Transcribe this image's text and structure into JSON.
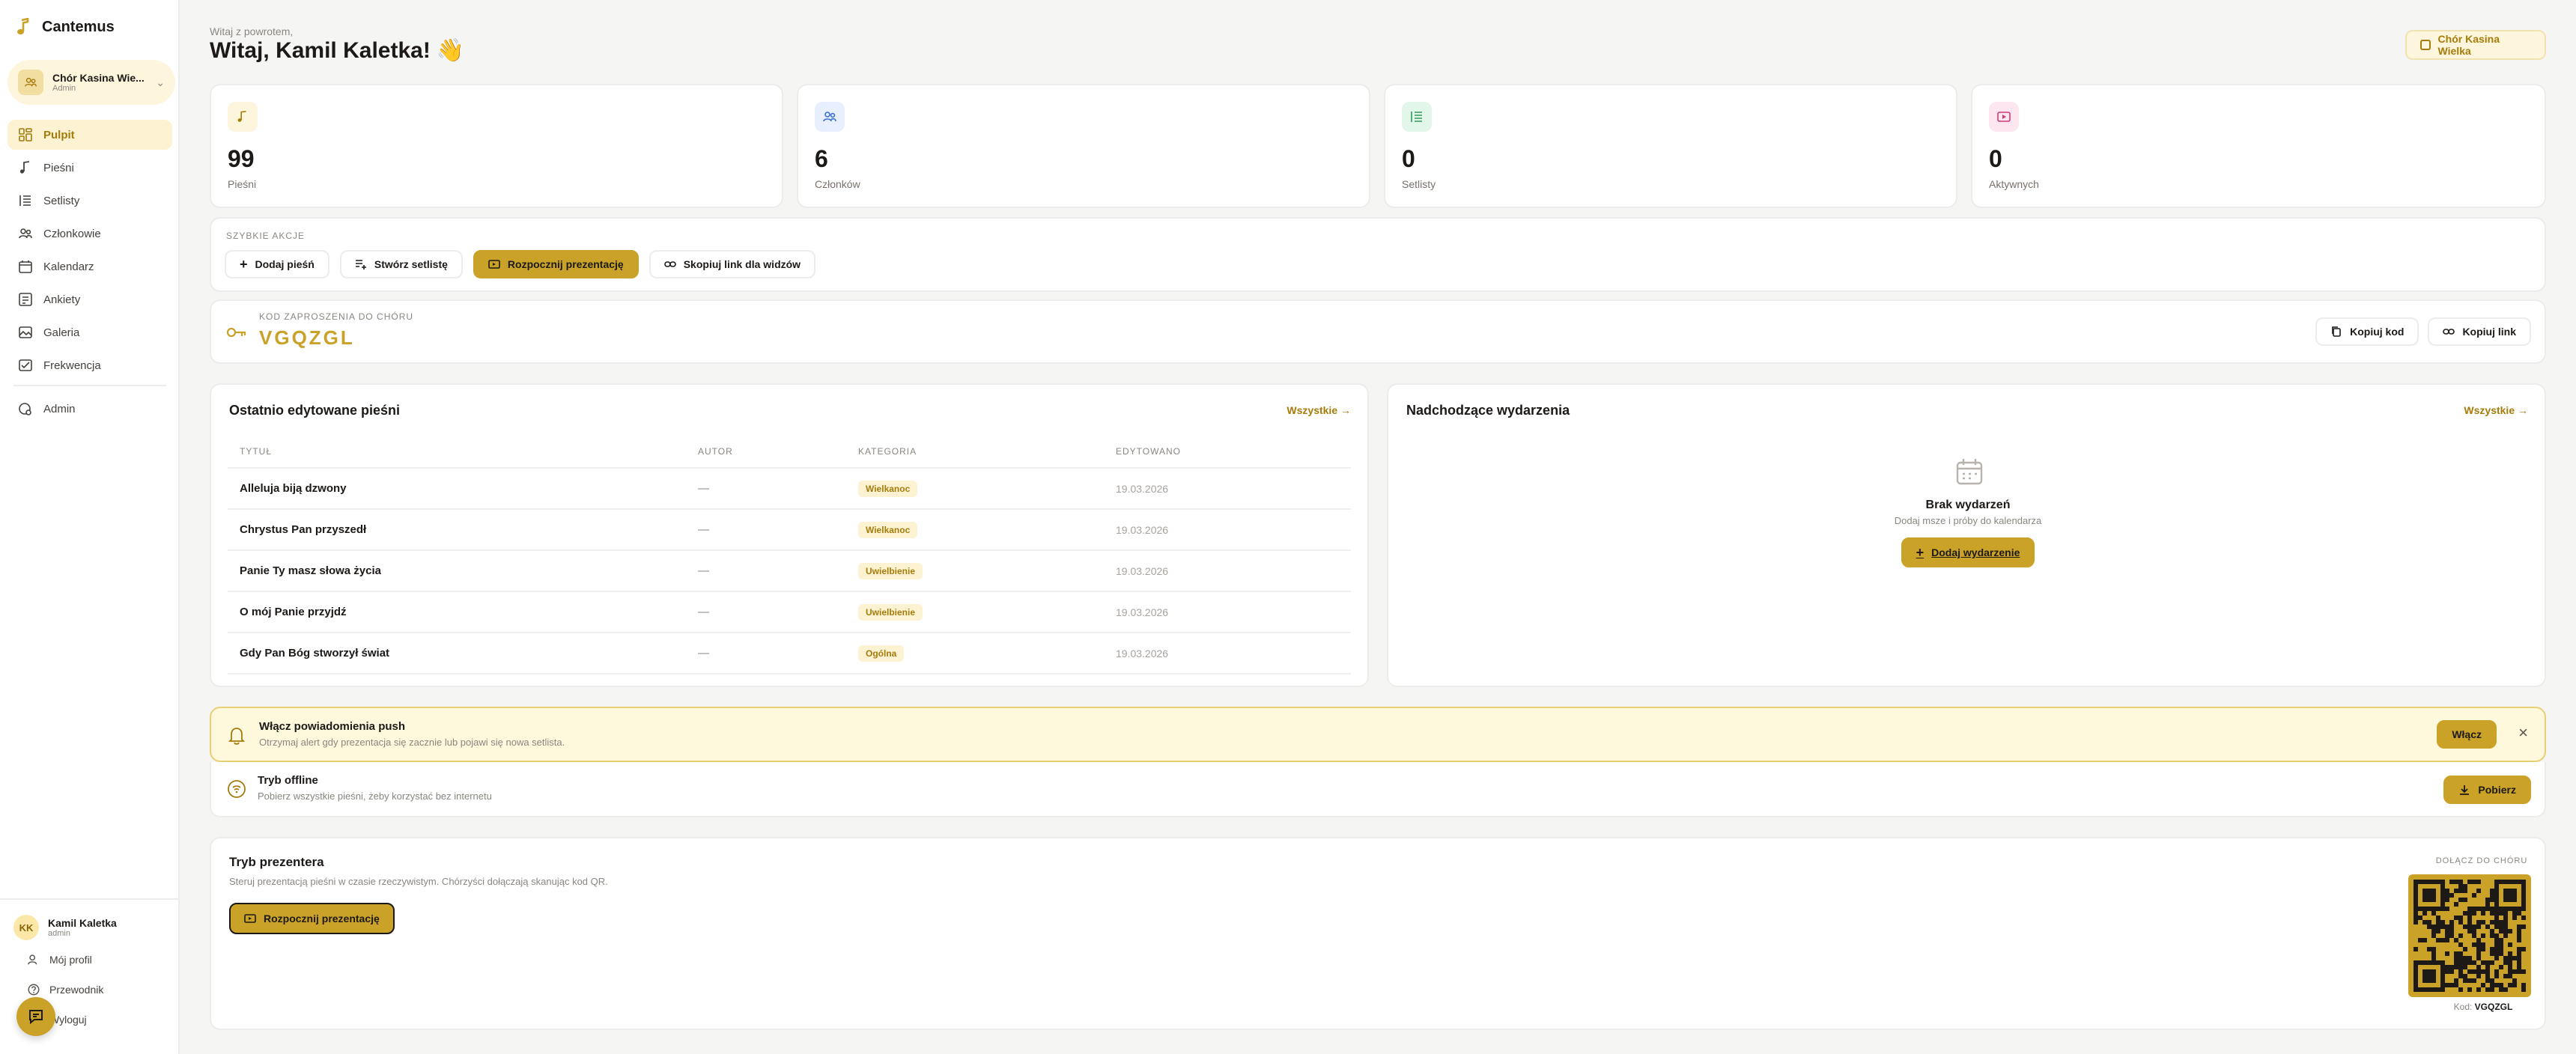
{
  "sidebar": {
    "brand": "Cantemus",
    "choir": {
      "name": "Chór Kasina Wie...",
      "role": "Admin"
    },
    "nav": [
      {
        "label": "Pulpit",
        "icon": "dashboard-icon",
        "active": true
      },
      {
        "label": "Pieśni",
        "icon": "music-note-icon"
      },
      {
        "label": "Setlisty",
        "icon": "list-icon"
      },
      {
        "label": "Członkowie",
        "icon": "users-icon"
      },
      {
        "label": "Kalendarz",
        "icon": "calendar-icon"
      },
      {
        "label": "Ankiety",
        "icon": "poll-icon"
      },
      {
        "label": "Galeria",
        "icon": "gallery-icon"
      },
      {
        "label": "Frekwencja",
        "icon": "attendance-icon"
      }
    ],
    "admin": {
      "label": "Admin",
      "icon": "admin-icon"
    },
    "user": {
      "initials": "KK",
      "name": "Kamil Kaletka",
      "role": "admin"
    },
    "user_links": [
      {
        "label": "Mój profil",
        "icon": "user-icon"
      },
      {
        "label": "Przewodnik",
        "icon": "help-icon"
      },
      {
        "label": "Wyloguj",
        "icon": "logout-icon"
      }
    ]
  },
  "header": {
    "small": "Witaj z powrotem,",
    "title": "Witaj, Kamil Kaletka!",
    "emoji": "👋",
    "choir_badge": "Chór Kasina Wielka"
  },
  "stats": [
    {
      "value": "99",
      "label": "Pieśni",
      "icon": "music-note-icon",
      "color": "#a67b0a",
      "bg": "#fdf6dc"
    },
    {
      "value": "6",
      "label": "Członków",
      "icon": "users-icon",
      "color": "#3b6fd4",
      "bg": "#e8efff"
    },
    {
      "value": "0",
      "label": "Setlisty",
      "icon": "list-icon",
      "color": "#2f9a5a",
      "bg": "#e3f6ea"
    },
    {
      "value": "0",
      "label": "Aktywnych",
      "icon": "presentation-icon",
      "color": "#d23a7a",
      "bg": "#fde6ef"
    }
  ],
  "quick": {
    "label": "Szybkie akcje",
    "add_song": "Dodaj pieśń",
    "create_setlist": "Stwórz setlistę",
    "start_presentation": "Rozpocznij prezentację",
    "copy_viewer_link": "Skopiuj link dla widzów"
  },
  "invite": {
    "label": "Kod zaproszenia do chóru",
    "code": "VGQZGL",
    "copy_code": "Kopiuj kod",
    "copy_link": "Kopiuj link"
  },
  "recent": {
    "title": "Ostatnio edytowane pieśni",
    "all": "Wszystkie →",
    "columns": [
      "Tytuł",
      "Autor",
      "Kategoria",
      "Edytowano"
    ],
    "rows": [
      {
        "title": "Alleluja biją dzwony",
        "author": "—",
        "category": "Wielkanoc",
        "date": "19.03.2026"
      },
      {
        "title": "Chrystus Pan przyszedł",
        "author": "—",
        "category": "Wielkanoc",
        "date": "19.03.2026"
      },
      {
        "title": "Panie Ty masz słowa życia",
        "author": "—",
        "category": "Uwielbienie",
        "date": "19.03.2026"
      },
      {
        "title": "O mój Panie przyjdź",
        "author": "—",
        "category": "Uwielbienie",
        "date": "19.03.2026"
      },
      {
        "title": "Gdy Pan Bóg stworzył świat",
        "author": "—",
        "category": "Ogólna",
        "date": "19.03.2026"
      }
    ]
  },
  "events": {
    "title": "Nadchodzące wydarzenia",
    "all": "Wszystkie →",
    "empty_title": "Brak wydarzeń",
    "empty_sub": "Dodaj msze i próby do kalendarza",
    "add": "Dodaj wydarzenie"
  },
  "push": {
    "title": "Włącz powiadomienia push",
    "sub": "Otrzymaj alert gdy prezentacja się zacznie lub pojawi się nowa setlista.",
    "enable": "Włącz"
  },
  "offline": {
    "title": "Tryb offline",
    "sub": "Pobierz wszystkie pieśni, żeby korzystać bez internetu",
    "download": "Pobierz"
  },
  "presenter": {
    "title": "Tryb prezentera",
    "sub": "Steruj prezentacją pieśni w czasie rzeczywistym. Chórzyści dołączają skanując kod QR.",
    "start": "Rozpocznij prezentację",
    "join_label": "Dołącz do chóru",
    "code_label": "Kod:",
    "code": "VGQZGL"
  },
  "colors": {
    "accent": "#c9a227",
    "accent_dark": "#a67b0a",
    "accent_bg": "#fdf6dc"
  }
}
